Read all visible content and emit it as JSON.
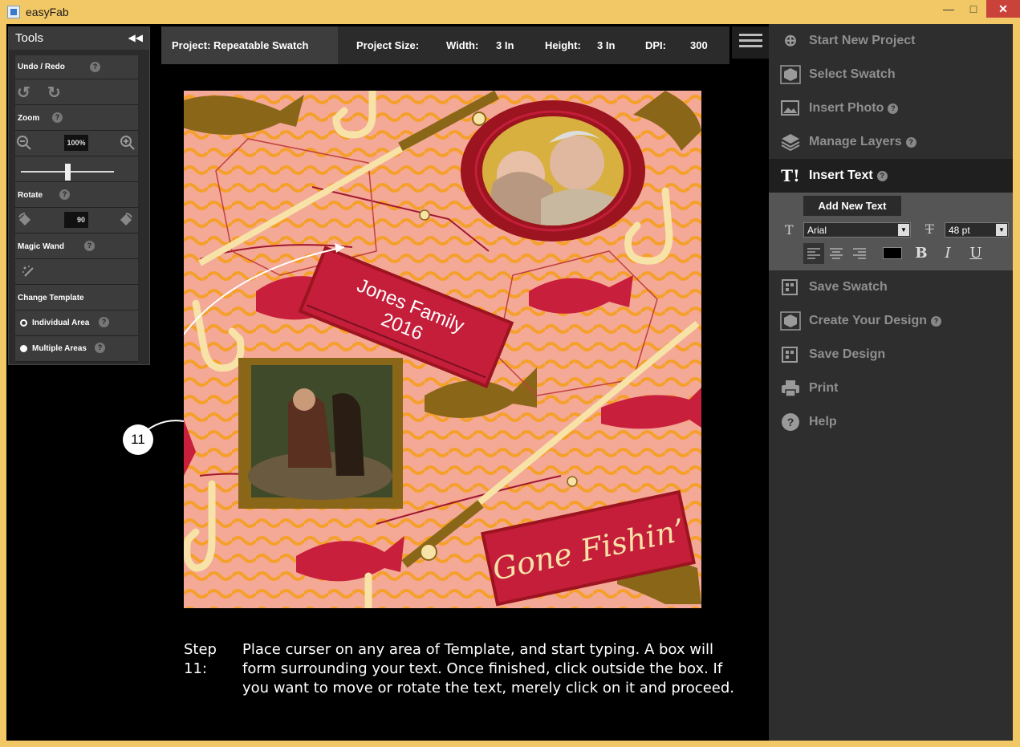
{
  "window": {
    "title": "easyFab",
    "minimize_glyph": "—",
    "maximize_glyph": "□",
    "close_glyph": "✕"
  },
  "tools": {
    "title": "Tools",
    "collapse_glyph": "◀◀",
    "undo_redo_label": "Undo / Redo",
    "zoom_label": "Zoom",
    "zoom_value": "100%",
    "zoom_slider_fraction": 0.5,
    "rotate_label": "Rotate",
    "rotate_value": "90",
    "magic_wand_label": "Magic Wand",
    "change_template_label": "Change Template",
    "individual_area_label": "Individual Area",
    "multiple_areas_label": "Multiple Areas",
    "help_glyph": "?"
  },
  "project": {
    "name_label": "Project: Repeatable Swatch",
    "size_label": "Project Size:",
    "width_label": "Width:",
    "width_value": "3 In",
    "height_label": "Height:",
    "height_value": "3 In",
    "dpi_label": "DPI:",
    "dpi_value": "300"
  },
  "canvas": {
    "banner_text_line1": "Jones Family",
    "banner_text_line2": "2016",
    "sign_text": "Gone Fishin’",
    "colors": {
      "background": "#f4a896",
      "wave": "#f5a02a",
      "fish_red": "#c8203c",
      "fish_brown": "#8a6618",
      "hook": "#f7e2a8",
      "banner": "#c41e3a",
      "frame_red": "#9c1420"
    }
  },
  "callout": {
    "number": "11"
  },
  "instructions": {
    "step_label": "Step 11:",
    "text": "Place curser on any area of Template, and start typing.  A box will form surrounding your text. Once finished, click outside the box.  If you want to move or rotate the text, merely click on it and proceed."
  },
  "menu": {
    "start_new_project": "Start New Project",
    "select_swatch": "Select Swatch",
    "insert_photo": "Insert Photo",
    "manage_layers": "Manage Layers",
    "insert_text": "Insert Text",
    "save_swatch": "Save Swatch",
    "create_your_design": "Create Your Design",
    "save_design": "Save Design",
    "print": "Print",
    "help": "Help"
  },
  "text_tools": {
    "add_new_text": "Add New Text",
    "font_value": "Arial",
    "size_value": "48 pt",
    "text_color": "#000000",
    "bold_glyph": "B",
    "italic_glyph": "I",
    "underline_glyph": "U",
    "dropdown_glyph": "▼"
  }
}
